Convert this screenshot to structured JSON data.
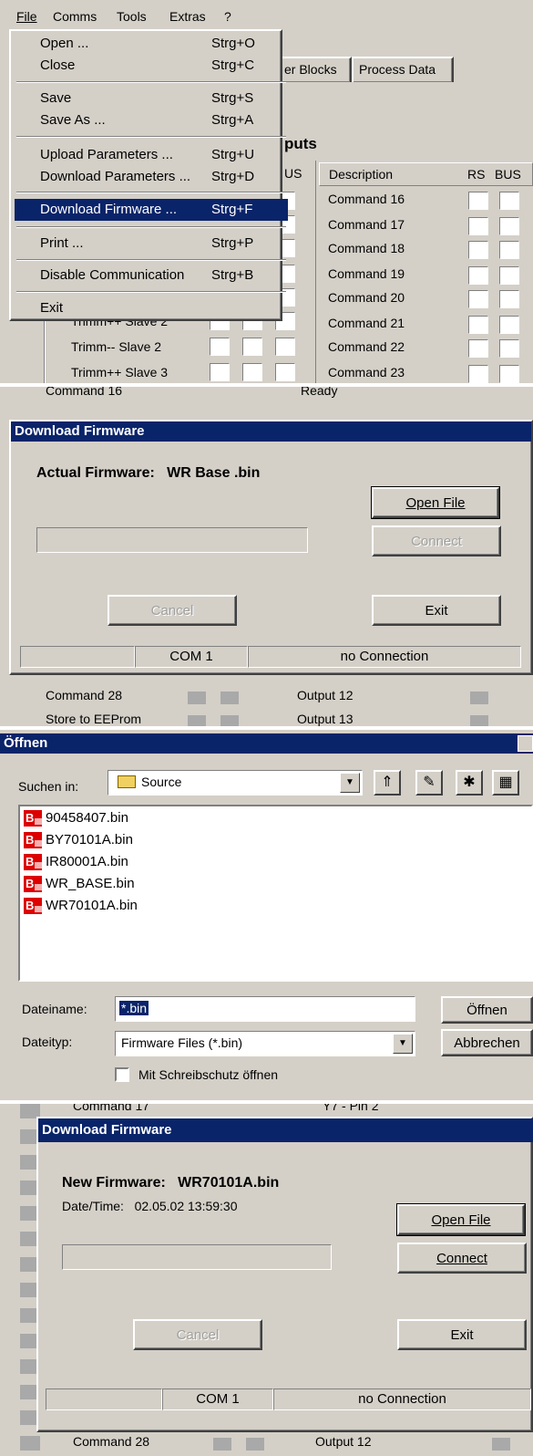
{
  "menubar": {
    "file": "File",
    "comms": "Comms",
    "tools": "Tools",
    "extras": "Extras",
    "help": "?"
  },
  "menu": {
    "open": {
      "label": "Open ...",
      "key": "Strg+O"
    },
    "close": {
      "label": "Close",
      "key": "Strg+C"
    },
    "save": {
      "label": "Save",
      "key": "Strg+S"
    },
    "save_as": {
      "label": "Save As ...",
      "key": "Strg+A"
    },
    "upload": {
      "label": "Upload Parameters ...",
      "key": "Strg+U"
    },
    "download": {
      "label": "Download Parameters ...",
      "key": "Strg+D"
    },
    "firmware": {
      "label": "Download Firmware ...",
      "key": "Strg+F"
    },
    "print": {
      "label": "Print ...",
      "key": "Strg+P"
    },
    "disable": {
      "label": "Disable Communication",
      "key": "Strg+B"
    },
    "exit": {
      "label": "Exit",
      "key": ""
    }
  },
  "bg": {
    "tab1": "er Blocks",
    "tab2": "Process Data",
    "section": "puts",
    "col_bus": "US",
    "col_desc": "Description",
    "col_rs": "RS",
    "col_bus2": "BUS",
    "left_rows": [
      "Trimm++ Slave 2",
      "Trimm-- Slave 2",
      "Trimm++ Slave 3"
    ],
    "right_rows": [
      "Command 16",
      "Command 17",
      "Command 18",
      "Command 19",
      "Command 20",
      "Command 21",
      "Command 22",
      "Command 23"
    ]
  },
  "dlg1": {
    "bg_top_left": "Command 16",
    "bg_top_left2": "Command 17",
    "bg_top_right": "Ready",
    "bg_top_right2": "Y7 - Pin 2",
    "title": "Download Firmware",
    "firmware_line": "Actual Firmware:   WR Base .bin",
    "open_file": "Open File",
    "connect": "Connect",
    "cancel": "Cancel",
    "exit": "Exit",
    "status_port": "COM 1",
    "status_conn": "no Connection",
    "bg_bottom": [
      "Command 28",
      "Store to EEProm"
    ],
    "bg_bottom_right": [
      "Output 12",
      "Output 13"
    ]
  },
  "dlg2": {
    "title": "Öffnen",
    "search_label": "Suchen in:",
    "folder": "Source",
    "files": [
      "90458407.bin",
      "BY70101A.bin",
      "IR80001A.bin",
      "WR_BASE.bin",
      "WR70101A.bin"
    ],
    "filename_label": "Dateiname:",
    "filename_value": "*.bin",
    "filetype_label": "Dateityp:",
    "filetype_value": "Firmware Files (*.bin)",
    "open_btn": "Öffnen",
    "cancel_btn": "Abbrechen",
    "readonly_label": "Mit Schreibschutz öffnen"
  },
  "dlg3": {
    "bg_top_left": "Command 17",
    "bg_top_right": "Y7 - Pin 2",
    "title": "Download Firmware",
    "firmware_line": "New Firmware:   WR70101A.bin",
    "date_line": "Date/Time:   02.05.02 13:59:30",
    "open_file": "Open File",
    "connect": "Connect",
    "cancel": "Cancel",
    "exit": "Exit",
    "status_port": "COM 1",
    "status_conn": "no Connection",
    "bg_bottom": "Command 28",
    "bg_bottom_right": "Output 12"
  }
}
